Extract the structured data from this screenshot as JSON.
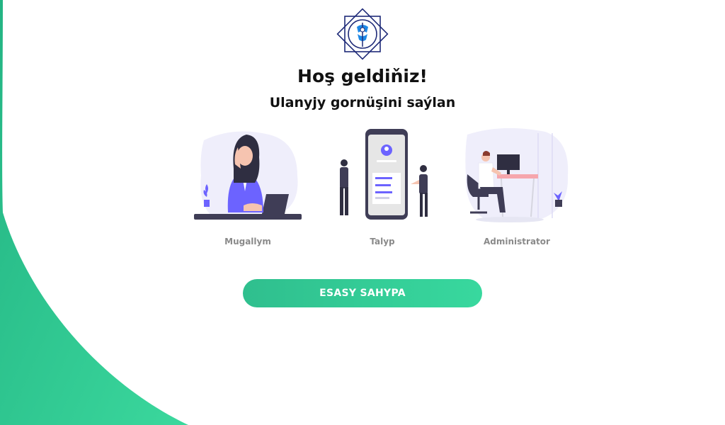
{
  "header": {
    "title": "Hoş geldiňiz!",
    "subtitle": "Ulanyjy gornüşini saýlan"
  },
  "roles": [
    {
      "label": "Mugallym",
      "icon": "teacher-illustration"
    },
    {
      "label": "Talyp",
      "icon": "student-illustration"
    },
    {
      "label": "Administrator",
      "icon": "administrator-illustration"
    }
  ],
  "button": {
    "label": "ESASY SAHYPA"
  },
  "colors": {
    "accent_green": "#34d399",
    "accent_purple": "#6c63ff",
    "text_dark": "#111111",
    "text_muted": "#8a8a8a",
    "logo_blue": "#1e3a8a"
  }
}
